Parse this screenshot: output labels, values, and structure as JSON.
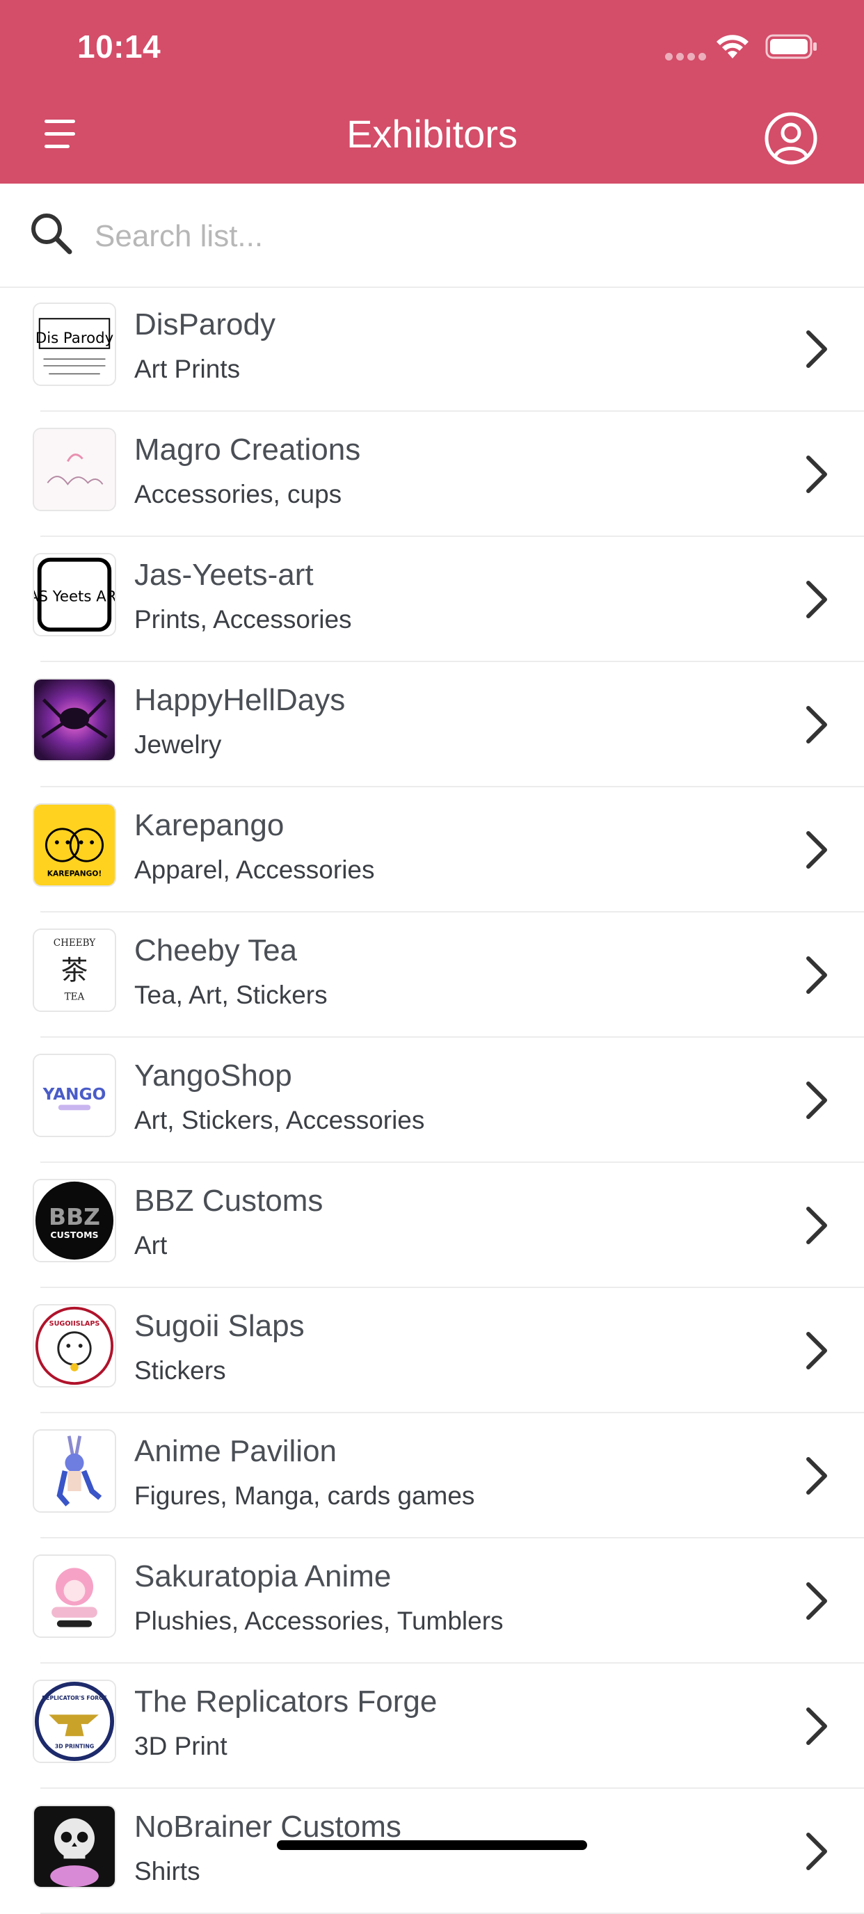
{
  "status_bar": {
    "time": "10:14"
  },
  "header": {
    "title": "Exhibitors",
    "menu_icon": "hamburger-menu-icon",
    "profile_icon": "user-circle-icon",
    "color": "#d44d69"
  },
  "search": {
    "placeholder": "Search list...",
    "value": ""
  },
  "logo_text": {
    "disparody": "Dis Parody",
    "jas": "JAS Yeets ART",
    "karepango": "KAREPANGO!",
    "cheeby": "茶",
    "cheeby_top": "CHEEBY",
    "cheeby_bottom": "TEA",
    "yango": "YANGO",
    "bbz": "BBZ",
    "bbz_sub": "CUSTOMS",
    "sugoii": "SUGOIISLAPS",
    "replicator": "REPLICATOR'S FORGE",
    "replicator_sub": "3D PRINTING"
  },
  "exhibitors": [
    {
      "name": "DisParody",
      "category": "Art Prints"
    },
    {
      "name": "Magro Creations",
      "category": "Accessories, cups"
    },
    {
      "name": "Jas-Yeets-art",
      "category": "Prints, Accessories"
    },
    {
      "name": "HappyHellDays",
      "category": "Jewelry"
    },
    {
      "name": "Karepango",
      "category": "Apparel, Accessories"
    },
    {
      "name": "Cheeby Tea",
      "category": "Tea, Art, Stickers"
    },
    {
      "name": "YangoShop",
      "category": "Art, Stickers, Accessories"
    },
    {
      "name": "BBZ Customs",
      "category": "Art"
    },
    {
      "name": "Sugoii Slaps",
      "category": "Stickers"
    },
    {
      "name": "Anime Pavilion",
      "category": "Figures, Manga, cards games"
    },
    {
      "name": "Sakuratopia Anime",
      "category": "Plushies, Accessories, Tumblers"
    },
    {
      "name": "The Replicators Forge",
      "category": "3D Print"
    },
    {
      "name": "NoBrainer Customs",
      "category": "Shirts"
    }
  ]
}
